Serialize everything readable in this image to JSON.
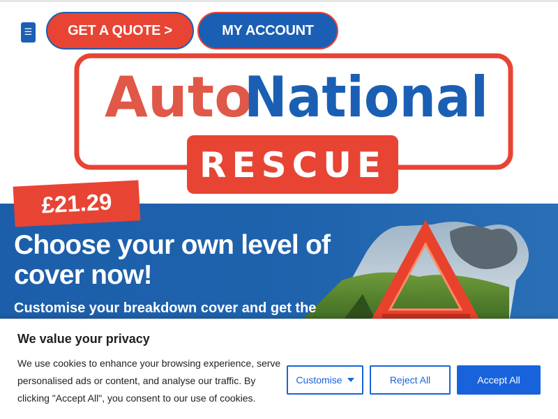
{
  "header": {
    "menu_icon": "☰",
    "quote_button": "GET A QUOTE >",
    "account_button": "MY ACCOUNT"
  },
  "logo": {
    "word_auto": "Auto",
    "word_national": "National",
    "word_rescue": "RESCUE"
  },
  "hero": {
    "price": "£21.29",
    "title": "Choose your own level of cover now!",
    "subtitle": "Customise your breakdown cover and get the"
  },
  "cookie_banner": {
    "title": "We value your privacy",
    "body": "We use cookies to enhance your browsing experience, serve personalised ads or content, and analyse our traffic. By clicking \"Accept All\", you consent to our use of cookies.",
    "customise_label": "Customise",
    "reject_label": "Reject All",
    "accept_label": "Accept All"
  },
  "colors": {
    "brand_red": "#e84434",
    "brand_blue": "#1a5fb4",
    "cookie_blue": "#1863dc"
  }
}
